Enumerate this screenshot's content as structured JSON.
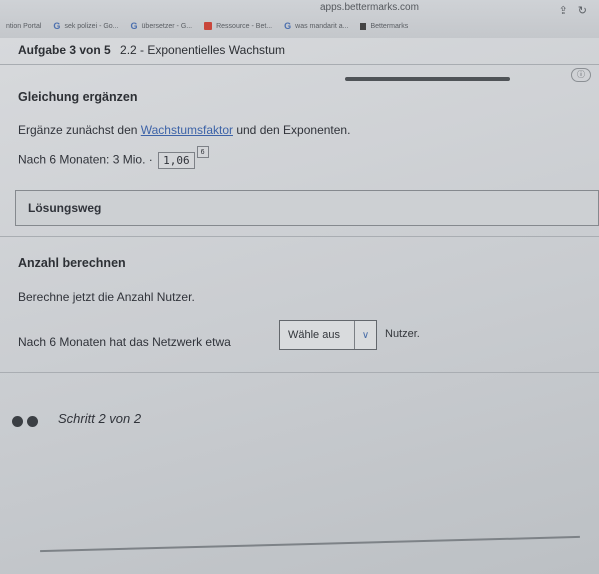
{
  "browser": {
    "url": "apps.bettermarks.com",
    "tabs": [
      {
        "label": "ntion Portal",
        "icon": "none"
      },
      {
        "label": "sek polizei - Go...",
        "icon": "google-icon"
      },
      {
        "label": "übersetzer - G...",
        "icon": "google-icon"
      },
      {
        "label": "Ressource - Bet...",
        "icon": "red-square-icon"
      },
      {
        "label": "was mandarit a...",
        "icon": "google-icon"
      },
      {
        "label": "Bettermarks",
        "icon": "bookmark-icon"
      }
    ]
  },
  "task": {
    "title": "Aufgabe 3 von 5",
    "subtitle": "2.2 - Exponentielles Wachstum"
  },
  "section1": {
    "heading": "Gleichung ergänzen",
    "instruction_pre": "Ergänze zunächst den ",
    "instruction_link": "Wachstumsfaktor",
    "instruction_post": " und den Exponenten.",
    "equation_pre": "Nach 6 Monaten: 3 Mio. · ",
    "factor_value": "1,06",
    "exponent_value": "6"
  },
  "solution": {
    "label": "Lösungsweg"
  },
  "section2": {
    "heading": "Anzahl berechnen",
    "instruction": "Berechne jetzt die Anzahl Nutzer.",
    "sentence_pre": "Nach 6 Monaten hat das Netzwerk etwa",
    "select_value": "Wähle aus",
    "sentence_post": "Nutzer."
  },
  "footer": {
    "step_text": "Schritt 2 von 2"
  }
}
